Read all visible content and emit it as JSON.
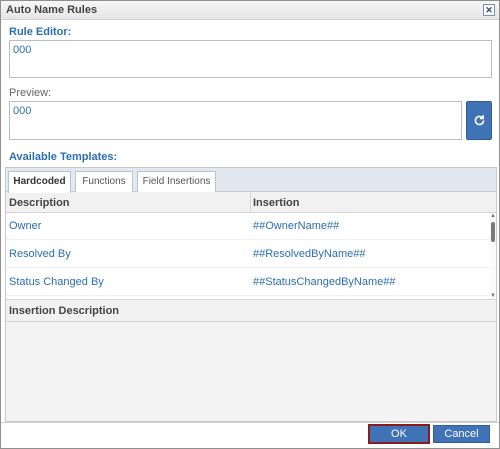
{
  "window": {
    "title": "Auto Name Rules",
    "close_icon": "close-icon"
  },
  "rule_editor": {
    "label": "Rule Editor:",
    "value": "000"
  },
  "preview": {
    "label": "Preview:",
    "value": "000",
    "refresh_icon": "refresh-icon"
  },
  "templates": {
    "label": "Available Templates:",
    "tabs": [
      {
        "label": "Hardcoded",
        "active": true
      },
      {
        "label": "Functions",
        "active": false
      },
      {
        "label": "Field Insertions",
        "active": false
      }
    ],
    "columns": {
      "description": "Description",
      "insertion": "Insertion"
    },
    "rows": [
      {
        "description": "Owner",
        "insertion": "##OwnerName##"
      },
      {
        "description": "Resolved By",
        "insertion": "##ResolvedByName##"
      },
      {
        "description": "Status Changed By",
        "insertion": "##StatusChangedByName##"
      }
    ],
    "insertion_description_label": "Insertion Description"
  },
  "buttons": {
    "ok": "OK",
    "cancel": "Cancel"
  },
  "colors": {
    "accent": "#3f73b6",
    "label_blue": "#2b6fb3",
    "ok_outline": "#8b1a1a"
  }
}
